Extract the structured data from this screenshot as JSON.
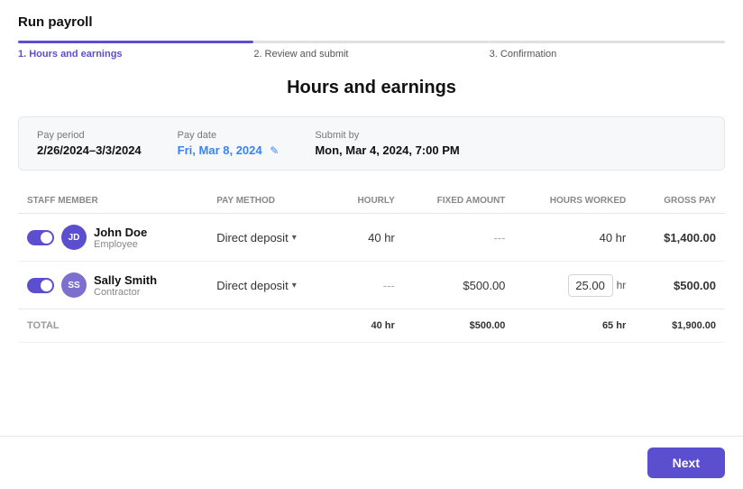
{
  "page": {
    "title": "Run payroll"
  },
  "steps": [
    {
      "id": "hours",
      "label": "1. Hours and earnings",
      "active": true
    },
    {
      "id": "review",
      "label": "2. Review and submit",
      "active": false
    },
    {
      "id": "confirmation",
      "label": "3. Confirmation",
      "active": false
    }
  ],
  "section_title": "Hours and earnings",
  "pay_info": {
    "pay_period_label": "Pay period",
    "pay_period_value": "2/26/2024–3/3/2024",
    "pay_date_label": "Pay date",
    "pay_date_value": "Fri, Mar 8, 2024",
    "submit_by_label": "Submit by",
    "submit_by_value": "Mon, Mar 4, 2024, 7:00 PM"
  },
  "table": {
    "columns": [
      "STAFF MEMBER",
      "PAY METHOD",
      "HOURLY",
      "FIXED AMOUNT",
      "HOURS WORKED",
      "GROSS PAY"
    ],
    "rows": [
      {
        "toggle": true,
        "initials": "JD",
        "avatar_class": "avatar-jd",
        "name": "John Doe",
        "role": "Employee",
        "pay_method": "Direct deposit",
        "hourly": "40 hr",
        "fixed_amount": "---",
        "hours_worked": "40 hr",
        "hours_input": null,
        "gross_pay": "$1,400.00"
      },
      {
        "toggle": true,
        "initials": "SS",
        "avatar_class": "avatar-ss",
        "name": "Sally Smith",
        "role": "Contractor",
        "pay_method": "Direct deposit",
        "hourly": "---",
        "fixed_amount": "$500.00",
        "hours_worked": null,
        "hours_input": "25.00",
        "gross_pay": "$500.00"
      }
    ],
    "total": {
      "label": "TOTAL",
      "hourly": "40 hr",
      "fixed_amount": "$500.00",
      "hours_worked": "65 hr",
      "gross_pay": "$1,900.00"
    }
  },
  "footer": {
    "next_label": "Next"
  }
}
